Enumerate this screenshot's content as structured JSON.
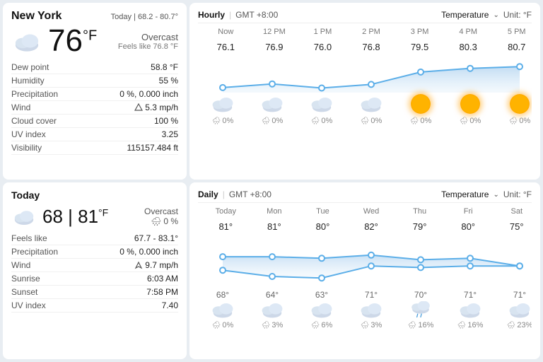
{
  "topLeft": {
    "city": "New York",
    "todayRange": "Today | 68.2 - 80.7°",
    "temperature": "76",
    "unit": "°F",
    "description": "Overcast",
    "feelsLike": "Feels like 76.8 °F",
    "cloudIcon": true,
    "stats": [
      {
        "label": "Dew point",
        "value": "58.8 °F",
        "icon": null
      },
      {
        "label": "Humidity",
        "value": "55 %",
        "icon": null
      },
      {
        "label": "Precipitation",
        "value": "0 %, 0.000 inch",
        "icon": null
      },
      {
        "label": "Wind",
        "value": "5.3 mp/h",
        "icon": "wind"
      },
      {
        "label": "Cloud cover",
        "value": "100 %",
        "icon": null
      },
      {
        "label": "UV index",
        "value": "3.25",
        "icon": null
      },
      {
        "label": "Visibility",
        "value": "115157.484 ft",
        "icon": null
      }
    ]
  },
  "bottomLeft": {
    "sectionLabel": "Today",
    "tempLow": "68",
    "tempHigh": "81",
    "unit": "°F",
    "description": "Overcast",
    "precipChance": "0 %",
    "stats": [
      {
        "label": "Feels like",
        "value": "67.7 - 83.1°",
        "icon": null
      },
      {
        "label": "Precipitation",
        "value": "0 %, 0.000 inch",
        "icon": null
      },
      {
        "label": "Wind",
        "value": "9.7 mp/h",
        "icon": "wind"
      },
      {
        "label": "Sunrise",
        "value": "6:03 AM",
        "icon": null
      },
      {
        "label": "Sunset",
        "value": "7:58 PM",
        "icon": null
      },
      {
        "label": "UV index",
        "value": "7.40",
        "icon": null
      }
    ]
  },
  "topRight": {
    "sectionLabel": "Hourly",
    "timezone": "GMT +8:00",
    "tempLabel": "Temperature",
    "unit": "Unit: °F",
    "hours": [
      {
        "label": "Now",
        "temp": "76.1",
        "weather": "cloud",
        "precip": "0%"
      },
      {
        "label": "12 PM",
        "temp": "76.9",
        "weather": "cloud",
        "precip": "0%"
      },
      {
        "label": "1 PM",
        "temp": "76.0",
        "weather": "cloud",
        "precip": "0%"
      },
      {
        "label": "2 PM",
        "temp": "76.8",
        "weather": "cloud",
        "precip": "0%"
      },
      {
        "label": "3 PM",
        "temp": "79.5",
        "weather": "sun",
        "precip": "0%"
      },
      {
        "label": "4 PM",
        "temp": "80.3",
        "weather": "sun",
        "precip": "0%"
      },
      {
        "label": "5 PM",
        "temp": "80.7",
        "weather": "sun",
        "precip": "0%"
      }
    ],
    "chartTemps": [
      76.1,
      76.9,
      76.0,
      76.8,
      79.5,
      80.3,
      80.7
    ]
  },
  "bottomRight": {
    "sectionLabel": "Daily",
    "timezone": "GMT +8:00",
    "tempLabel": "Temperature",
    "unit": "Unit: °F",
    "days": [
      {
        "label": "Today",
        "high": "81°",
        "low": "68°",
        "weather": "cloud",
        "precip": "0%"
      },
      {
        "label": "Mon",
        "high": "81°",
        "low": "64°",
        "weather": "cloud",
        "precip": "3%"
      },
      {
        "label": "Tue",
        "high": "80°",
        "low": "63°",
        "weather": "cloud",
        "precip": "6%"
      },
      {
        "label": "Wed",
        "high": "82°",
        "low": "71°",
        "weather": "cloud",
        "precip": "3%"
      },
      {
        "label": "Thu",
        "high": "79°",
        "low": "70°",
        "weather": "rain",
        "precip": "16%"
      },
      {
        "label": "Fri",
        "high": "80°",
        "low": "71°",
        "weather": "cloud",
        "precip": "16%"
      },
      {
        "label": "Sat",
        "high": "75°",
        "low": "71°",
        "weather": "cloud",
        "precip": "23%"
      }
    ],
    "chartHighs": [
      81,
      81,
      80,
      82,
      79,
      80,
      75
    ],
    "chartLows": [
      68,
      64,
      63,
      71,
      70,
      71,
      71
    ]
  }
}
